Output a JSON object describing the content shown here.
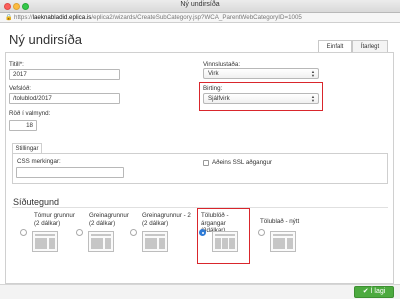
{
  "window": {
    "title": "Ný undirsíða"
  },
  "address": {
    "scheme": "https://",
    "host": "laeknabladid.eplica.is",
    "path": "/eplica2/wizards/CreateSubCategory.jsp?WCA_ParentWebCategoryID=1005"
  },
  "page": {
    "title": "Ný undirsíða"
  },
  "mode_tabs": {
    "simple": "Einfalt",
    "advanced": "Ítarlegt"
  },
  "form": {
    "title_label": "Titill*:",
    "title_value": "2017",
    "address_label": "Vefslóð:",
    "address_value": "/tolublod/2017",
    "order_label": "Röð í valmynd:",
    "order_value": "18",
    "workflow_label": "Vinnslustaða:",
    "workflow_value": "Virk",
    "publish_label": "Birting:",
    "publish_value": "Sjálfvirk"
  },
  "settings": {
    "tab_label": "Stillingar",
    "css_label": "CSS merkingar:",
    "css_value": "",
    "ssl_label": "Aðeins SSL aðgangur"
  },
  "layout": {
    "heading": "Síðutegund",
    "options": [
      {
        "label": "Tómur grunnur (2 dálkar)",
        "selected": false
      },
      {
        "label": "Greinagrunnur (2 dálkar)",
        "selected": false
      },
      {
        "label": "Greinagrunnur - 2 (2 dálkar)",
        "selected": false
      },
      {
        "label": "Tölublöð - árgangar (3dálkar)",
        "selected": true
      },
      {
        "label": "Tölublað - nýtt",
        "selected": false
      }
    ]
  },
  "footer": {
    "ok_label": "Í lagi"
  },
  "colors": {
    "highlight": "#d9262c",
    "ok_button": "#4caa3f",
    "radio_selected": "#2f7bd6"
  }
}
